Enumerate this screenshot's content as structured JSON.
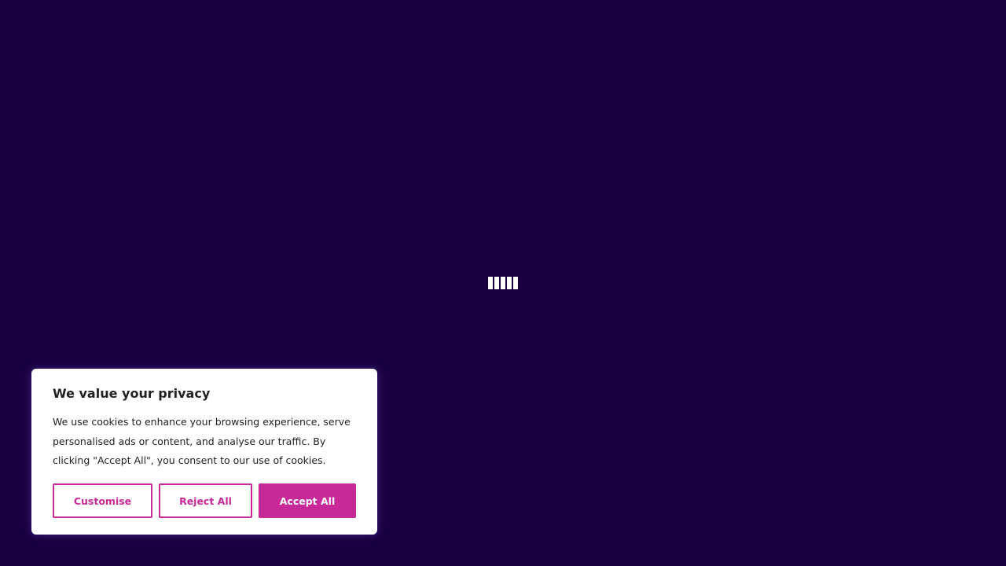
{
  "colors": {
    "background": "#170040",
    "accent": "#c72a98",
    "banner_bg": "#ffffff",
    "text": "#212121"
  },
  "loader": {
    "bars": 5
  },
  "cookie_banner": {
    "title": "We value your privacy",
    "body": "We use cookies to enhance your browsing experience, serve personalised ads or content, and analyse our traffic. By clicking \"Accept All\", you consent to our use of cookies.",
    "buttons": {
      "customise": "Customise",
      "reject_all": "Reject All",
      "accept_all": "Accept All"
    }
  }
}
